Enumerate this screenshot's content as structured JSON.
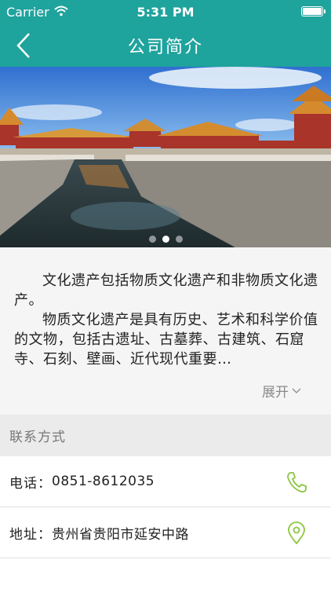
{
  "status_bar": {
    "carrier": "Carrier",
    "time": "5:31 PM",
    "icons": [
      "wifi-icon",
      "battery-icon"
    ]
  },
  "nav": {
    "title": "公司简介",
    "back_icon": "chevron-left-icon"
  },
  "banner": {
    "page_count": 3,
    "active_page": 2
  },
  "intro": {
    "paragraph_1": "文化遗产包括物质文化遗产和非物质文化遗产。",
    "paragraph_2": "物质文化遗产是具有历史、艺术和科学价值的文物，包括古遗址、古墓葬、古建筑、石窟寺、石刻、壁画、近代现代重要…",
    "expand_label": "展开"
  },
  "contact": {
    "section_title": "联系方式",
    "phone_label": "电话：",
    "phone_value": "0851-8612035",
    "address_label": "地址：",
    "address_value": "贵州省贵阳市延安中路"
  },
  "colors": {
    "brand": "#1fa39d",
    "icon_accent": "#8cc63f"
  }
}
